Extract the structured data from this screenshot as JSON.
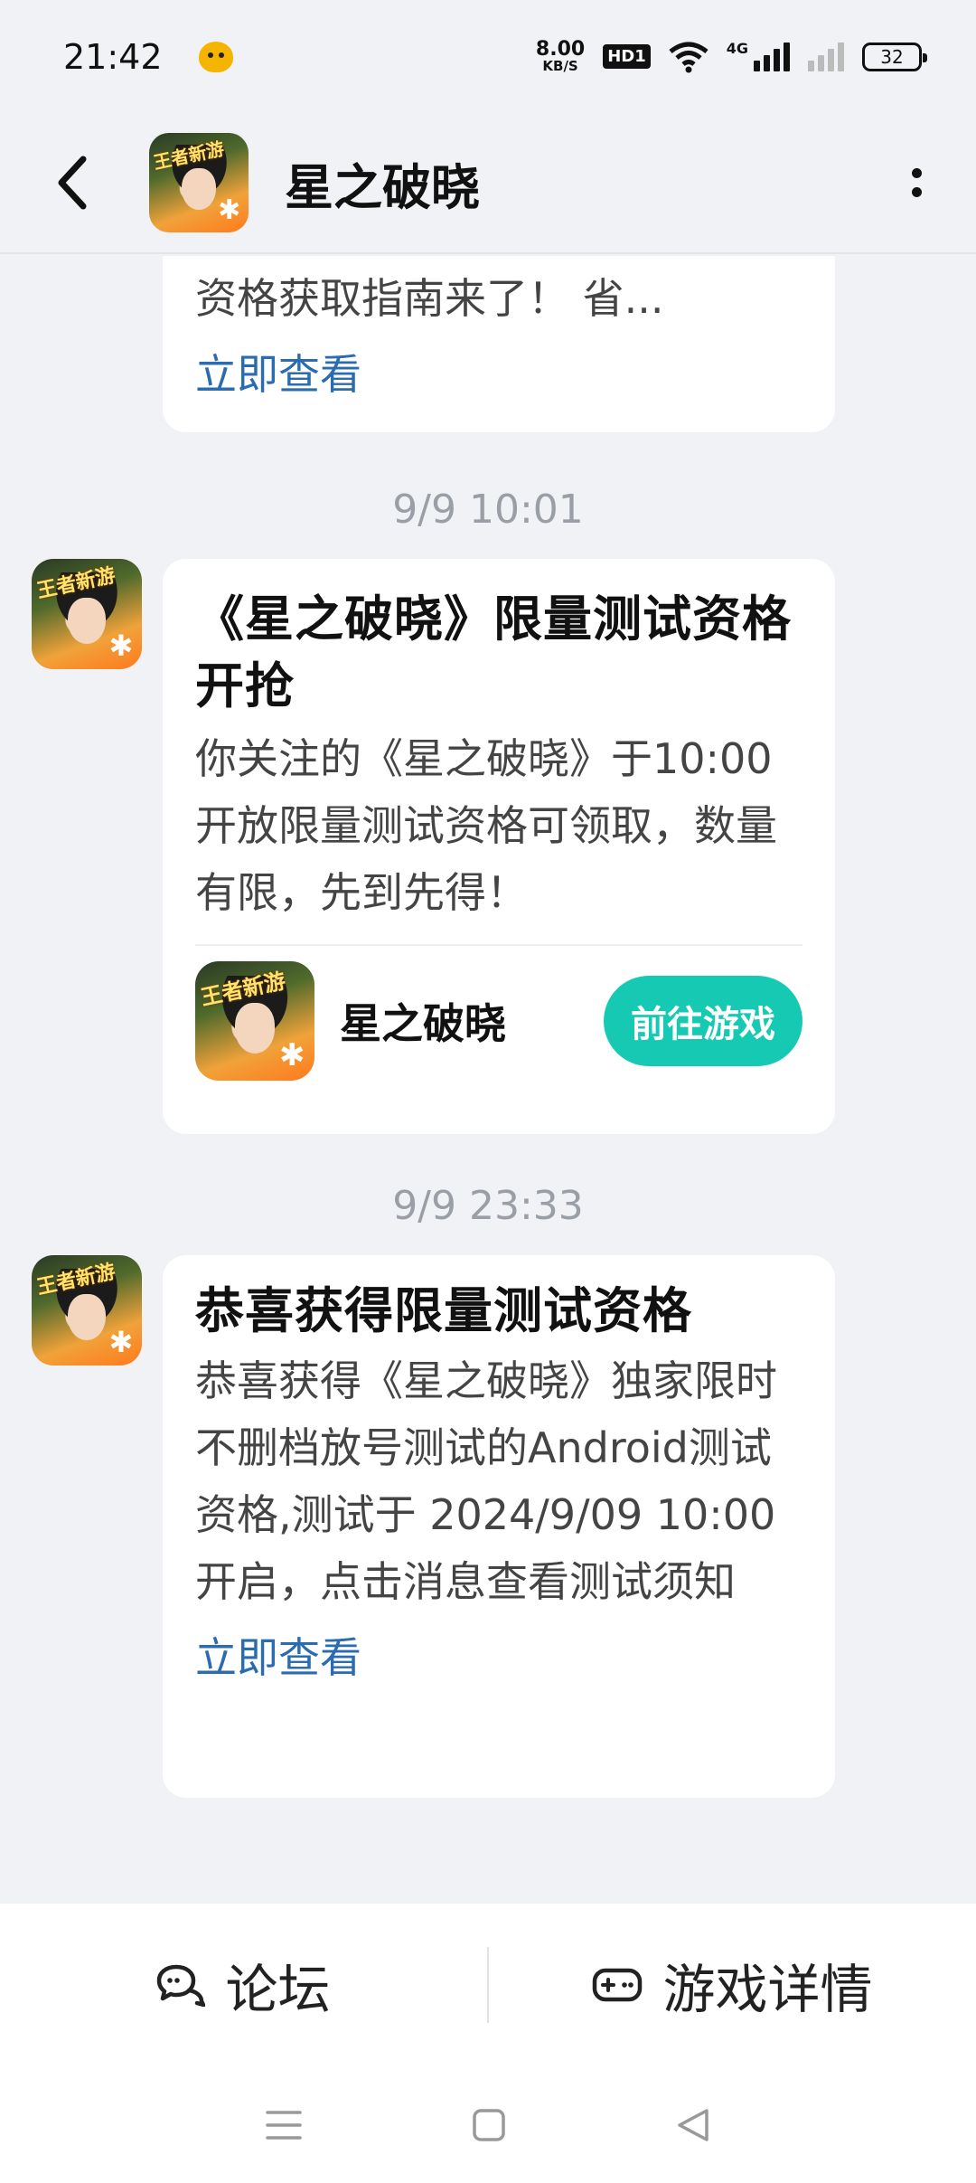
{
  "status_bar": {
    "time": "21:42",
    "net_speed_value": "8.00",
    "net_speed_unit": "KB/S",
    "hd_label": "HD1",
    "lte_label": "4G",
    "battery": "32"
  },
  "header": {
    "title": "星之破晓"
  },
  "game_icon_tag": "王者新游",
  "messages": [
    {
      "body": "资格获取指南来了！ 省...",
      "link": "立即查看"
    },
    {
      "time": "9/9  10:01",
      "title": "《星之破晓》限量测试资格开抢",
      "body": "你关注的《星之破晓》于10:00 开放限量测试资格可领取，数量有限，先到先得！",
      "game_name": "星之破晓",
      "button": "前往游戏"
    },
    {
      "time": "9/9  23:33",
      "title": "恭喜获得限量测试资格",
      "body": "恭喜获得《星之破晓》独家限时不删档放号测试的Android测试资格,测试于 2024/9/09 10:00 开启，点击消息查看测试须知",
      "link": "立即查看"
    }
  ],
  "bottom_tabs": [
    {
      "label": "论坛",
      "icon": "forum-icon"
    },
    {
      "label": "游戏详情",
      "icon": "gamepad-icon"
    }
  ],
  "colors": {
    "accent": "#16c9b3",
    "link": "#2a6bb1",
    "background": "#f0f2f5"
  }
}
